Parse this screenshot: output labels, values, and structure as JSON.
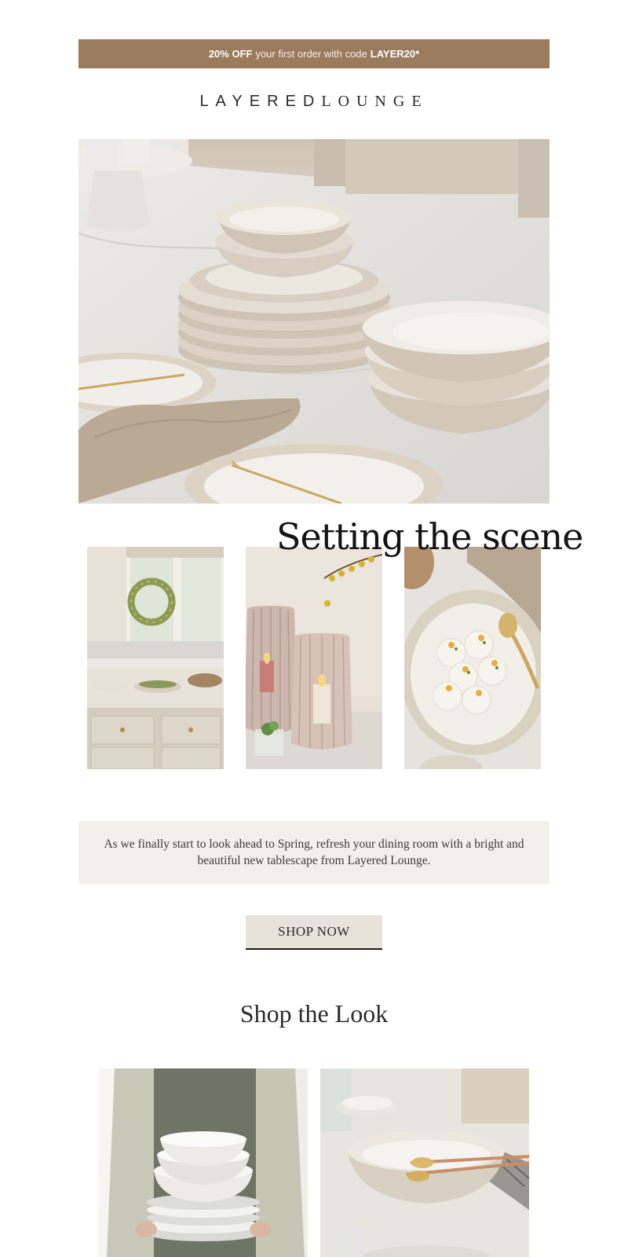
{
  "promo": {
    "discount": "20% OFF",
    "text": "your first order with code",
    "code": "LAYER20*"
  },
  "brand": {
    "part1": "LAYERED",
    "part2": "LOUNGE"
  },
  "hero": {
    "title": "Setting the scene"
  },
  "body": {
    "copy": "As we finally start to look ahead to Spring, refresh your dining room with a bright and beautiful new tablescape from Layered Lounge."
  },
  "cta": {
    "label": "SHOP NOW"
  },
  "shop_look": {
    "heading": "Shop the Look"
  },
  "colors": {
    "promo_bg": "#9b7b5e",
    "copy_bg": "#f2f0eb",
    "button_bg": "#e8e3da"
  }
}
